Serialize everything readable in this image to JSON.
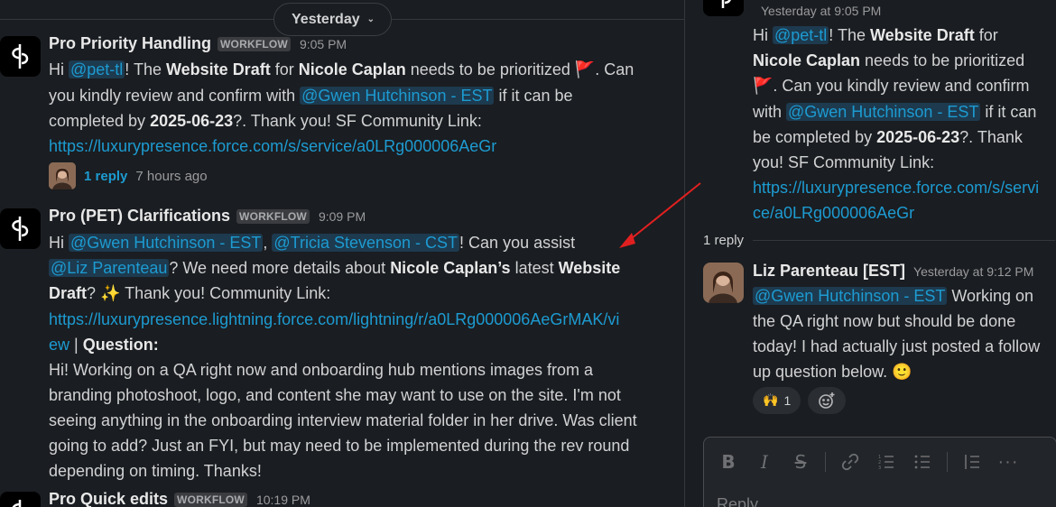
{
  "date_divider": {
    "label": "Yesterday"
  },
  "messages": [
    {
      "name": "Pro Priority Handling",
      "badge": "WORKFLOW",
      "time": "9:05 PM",
      "replies": {
        "count": "1 reply",
        "ago": "7 hours ago"
      }
    },
    {
      "name": "Pro (PET) Clarifications",
      "badge": "WORKFLOW",
      "time": "9:09 PM"
    },
    {
      "name": "Pro Quick edits",
      "badge": "WORKFLOW",
      "time": "10:19 PM"
    }
  ],
  "m1": {
    "hi": "Hi ",
    "mention_pet": "@pet-tl",
    "t1": "!  The ",
    "b1": "Website Draft",
    "t2": " for ",
    "b2": "Nicole Caplan",
    "t3": " needs to be prioritized ",
    "flag": "🚩",
    "t4": ".  Can",
    "t5": "you kindly review and confirm with ",
    "mention_gwen": "@Gwen Hutchinson - EST",
    "t6": " if it can be",
    "t7": "completed by ",
    "b3": "2025-06-23",
    "t8": "?. Thank you! SF Community Link:",
    "link": "https://luxurypresence.force.com/s/service/a0LRg000006AeGr"
  },
  "m2": {
    "hi": "Hi ",
    "mention_gwen": "@Gwen Hutchinson - EST",
    "comma": ", ",
    "mention_tricia": "@Tricia Stevenson - CST",
    "t1": "! Can you assist",
    "mention_liz": "@Liz Parenteau",
    "t2": "? We need more details about ",
    "b1": "Nicole Caplan’s",
    "t3": " latest ",
    "b2": "Website",
    "b3": "Draft",
    "t4": "? ",
    "sparkle": "✨",
    "t5": " Thank you! Community Link:",
    "link_a": "https://luxurypresence.lightning.force.com/lightning/r/a0LRg000006AeGrMAK/vi",
    "link_b": "ew",
    "t6": " | ",
    "b4": "Question:",
    "q1": "Hi! Working on a QA right now and onboarding hub mentions images from a",
    "q2": "branding photoshoot, logo, and content she may want to use on the site. I'm not",
    "q3": "seeing anything in the onboarding interview material folder in her drive. Was client",
    "q4": "going to add? Just an FYI, but may need to be implemented during the rev round",
    "q5": "depending on timing. Thanks!"
  },
  "thread": {
    "parent_time": "Yesterday at 9:05 PM",
    "p": {
      "hi": "Hi ",
      "mention_pet": "@pet-tl",
      "t1": "!  The ",
      "b1": "Website Draft",
      "t2": " for",
      "b2": "Nicole Caplan",
      "t3": " needs to be prioritized",
      "flag": "🚩",
      "t4": ".  Can you kindly review and confirm",
      "t5": "with ",
      "mention_gwen": "@Gwen Hutchinson - EST",
      "t6": " if it can",
      "t7": "be completed by ",
      "b3": "2025-06-23",
      "t8": "?. Thank",
      "t9": "you! SF Community Link:",
      "link_a": "https://luxurypresence.force.com/s/servi",
      "link_b": "ce/a0LRg000006AeGr"
    },
    "replies_label": "1 reply",
    "reply": {
      "name": "Liz Parenteau [EST]",
      "time": "Yesterday at 9:12 PM",
      "mention": "@Gwen Hutchinson - EST",
      "t1": " Working on",
      "t2": "the QA right now but should be done",
      "t3": "today! I had actually just posted a follow",
      "t4": "up question below. ",
      "smile": "🙂"
    },
    "reactions": [
      {
        "emoji": "🙌",
        "count": "1"
      }
    ],
    "composer": {
      "placeholder": "Reply…",
      "tools": [
        "bold-icon",
        "italic-icon",
        "strikethrough-icon",
        "link-icon",
        "ordered-list-icon",
        "bulleted-list-icon",
        "blockquote-icon",
        "more-icon"
      ]
    }
  },
  "colors": {
    "background": "#1a1d21",
    "mention_bg": "#1d3a4f",
    "link": "#1d9bd1",
    "arrow": "#e02020"
  }
}
